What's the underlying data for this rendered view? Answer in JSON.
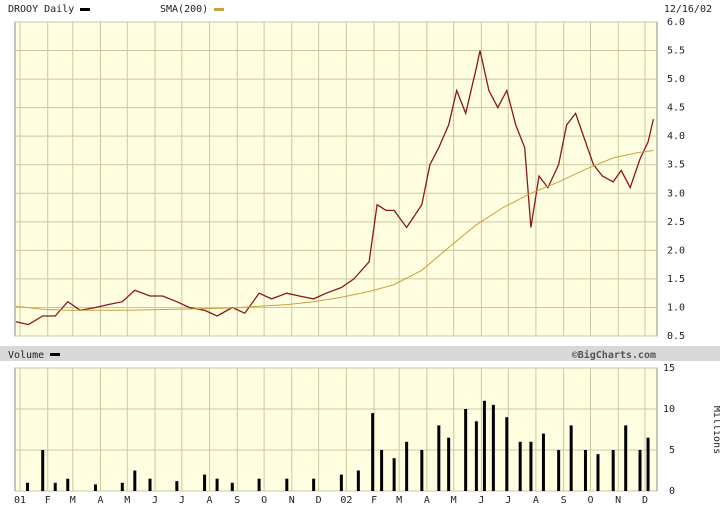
{
  "header": {
    "symbol_label": "DROOY Daily",
    "sma_label": "SMA(200)",
    "date": "12/16/02"
  },
  "volume_header": {
    "label": "Volume",
    "watermark": "©BigCharts.com"
  },
  "colors": {
    "plot_bg": "#fffee0",
    "grid": "#c9c9a0",
    "price_bars": "#8a1818",
    "sma": "#c9a040",
    "volume_bars": "#000000",
    "band": "#d8d8d8"
  },
  "chart_data": [
    {
      "type": "ohlc-line",
      "title": "DROOY Daily",
      "series": [
        {
          "name": "DROOY Daily",
          "points": [
            [
              "2001-01-02",
              0.75
            ],
            [
              "2001-01-16",
              0.7
            ],
            [
              "2001-02-01",
              0.85
            ],
            [
              "2001-02-15",
              0.85
            ],
            [
              "2001-03-01",
              1.1
            ],
            [
              "2001-03-15",
              0.95
            ],
            [
              "2001-04-01",
              1.0
            ],
            [
              "2001-04-15",
              1.05
            ],
            [
              "2001-05-01",
              1.1
            ],
            [
              "2001-05-15",
              1.3
            ],
            [
              "2001-06-01",
              1.2
            ],
            [
              "2001-06-15",
              1.2
            ],
            [
              "2001-07-01",
              1.1
            ],
            [
              "2001-07-15",
              1.0
            ],
            [
              "2001-08-01",
              0.95
            ],
            [
              "2001-08-15",
              0.85
            ],
            [
              "2001-09-01",
              1.0
            ],
            [
              "2001-09-15",
              0.9
            ],
            [
              "2001-10-01",
              1.25
            ],
            [
              "2001-10-15",
              1.15
            ],
            [
              "2001-11-01",
              1.25
            ],
            [
              "2001-11-15",
              1.2
            ],
            [
              "2001-12-01",
              1.15
            ],
            [
              "2001-12-15",
              1.25
            ],
            [
              "2002-01-01",
              1.35
            ],
            [
              "2002-01-15",
              1.5
            ],
            [
              "2002-02-01",
              1.8
            ],
            [
              "2002-02-10",
              2.8
            ],
            [
              "2002-02-20",
              2.7
            ],
            [
              "2002-03-01",
              2.7
            ],
            [
              "2002-03-15",
              2.4
            ],
            [
              "2002-04-01",
              2.8
            ],
            [
              "2002-04-10",
              3.5
            ],
            [
              "2002-04-20",
              3.8
            ],
            [
              "2002-05-01",
              4.2
            ],
            [
              "2002-05-10",
              4.8
            ],
            [
              "2002-05-20",
              4.4
            ],
            [
              "2002-06-01",
              5.2
            ],
            [
              "2002-06-05",
              5.5
            ],
            [
              "2002-06-15",
              4.8
            ],
            [
              "2002-06-25",
              4.5
            ],
            [
              "2002-07-05",
              4.8
            ],
            [
              "2002-07-15",
              4.2
            ],
            [
              "2002-07-25",
              3.8
            ],
            [
              "2002-08-01",
              2.4
            ],
            [
              "2002-08-10",
              3.3
            ],
            [
              "2002-08-20",
              3.1
            ],
            [
              "2002-09-01",
              3.5
            ],
            [
              "2002-09-10",
              4.2
            ],
            [
              "2002-09-20",
              4.4
            ],
            [
              "2002-10-01",
              3.9
            ],
            [
              "2002-10-10",
              3.5
            ],
            [
              "2002-10-20",
              3.3
            ],
            [
              "2002-11-01",
              3.2
            ],
            [
              "2002-11-10",
              3.4
            ],
            [
              "2002-11-20",
              3.1
            ],
            [
              "2002-12-01",
              3.6
            ],
            [
              "2002-12-10",
              3.9
            ],
            [
              "2002-12-16",
              4.3
            ]
          ]
        },
        {
          "name": "SMA(200)",
          "points": [
            [
              "2001-01-02",
              1.02
            ],
            [
              "2001-02-01",
              0.97
            ],
            [
              "2001-03-01",
              0.95
            ],
            [
              "2001-04-01",
              0.95
            ],
            [
              "2001-05-01",
              0.95
            ],
            [
              "2001-06-01",
              0.96
            ],
            [
              "2001-07-01",
              0.97
            ],
            [
              "2001-08-01",
              0.98
            ],
            [
              "2001-09-01",
              0.99
            ],
            [
              "2001-10-01",
              1.02
            ],
            [
              "2001-11-01",
              1.05
            ],
            [
              "2001-12-01",
              1.1
            ],
            [
              "2002-01-01",
              1.18
            ],
            [
              "2002-02-01",
              1.28
            ],
            [
              "2002-03-01",
              1.4
            ],
            [
              "2002-04-01",
              1.65
            ],
            [
              "2002-05-01",
              2.05
            ],
            [
              "2002-06-01",
              2.45
            ],
            [
              "2002-07-01",
              2.75
            ],
            [
              "2002-08-01",
              3.0
            ],
            [
              "2002-09-01",
              3.2
            ],
            [
              "2002-10-01",
              3.42
            ],
            [
              "2002-11-01",
              3.62
            ],
            [
              "2002-12-01",
              3.72
            ],
            [
              "2002-12-16",
              3.75
            ]
          ]
        }
      ],
      "y_ticks": [
        "6.0",
        "5.5",
        "5.0",
        "4.5",
        "4.0",
        "3.5",
        "3.0",
        "2.5",
        "2.0",
        "1.5",
        "1.0",
        "0.5"
      ],
      "ylim": [
        0.5,
        6.0
      ],
      "x_tick_labels": [
        "01",
        "F",
        "M",
        "A",
        "M",
        "J",
        "J",
        "A",
        "S",
        "O",
        "N",
        "D",
        "02",
        "F",
        "M",
        "A",
        "M",
        "J",
        "J",
        "A",
        "S",
        "O",
        "N",
        "D"
      ],
      "xlim": [
        "2001-01-01",
        "2002-12-20"
      ],
      "grid": true,
      "legend": "top-left"
    },
    {
      "type": "bar",
      "title": "Volume",
      "ylabel": "Millions",
      "y_ticks": [
        "15",
        "10",
        "5",
        "0"
      ],
      "ylim": [
        0,
        15
      ],
      "x_tick_labels": [
        "01",
        "F",
        "M",
        "A",
        "M",
        "J",
        "J",
        "A",
        "S",
        "O",
        "N",
        "D",
        "02",
        "F",
        "M",
        "A",
        "M",
        "J",
        "J",
        "A",
        "S",
        "O",
        "N",
        "D"
      ],
      "xlim": [
        "2001-01-01",
        "2002-12-20"
      ],
      "series": [
        {
          "points": [
            [
              "2001-01-15",
              1.0
            ],
            [
              "2001-02-01",
              5.0
            ],
            [
              "2001-02-15",
              1.0
            ],
            [
              "2001-03-01",
              1.5
            ],
            [
              "2001-04-01",
              0.8
            ],
            [
              "2001-05-01",
              1.0
            ],
            [
              "2001-05-15",
              2.5
            ],
            [
              "2001-06-01",
              1.5
            ],
            [
              "2001-07-01",
              1.2
            ],
            [
              "2001-08-01",
              2.0
            ],
            [
              "2001-08-15",
              1.5
            ],
            [
              "2001-09-01",
              1.0
            ],
            [
              "2001-10-01",
              1.5
            ],
            [
              "2001-11-01",
              1.5
            ],
            [
              "2001-12-01",
              1.5
            ],
            [
              "2002-01-01",
              2.0
            ],
            [
              "2002-01-20",
              2.5
            ],
            [
              "2002-02-05",
              9.5
            ],
            [
              "2002-02-15",
              5.0
            ],
            [
              "2002-03-01",
              4.0
            ],
            [
              "2002-03-15",
              6.0
            ],
            [
              "2002-04-01",
              5.0
            ],
            [
              "2002-04-20",
              8.0
            ],
            [
              "2002-05-01",
              6.5
            ],
            [
              "2002-05-20",
              10.0
            ],
            [
              "2002-06-01",
              8.5
            ],
            [
              "2002-06-10",
              11.0
            ],
            [
              "2002-06-20",
              10.5
            ],
            [
              "2002-07-05",
              9.0
            ],
            [
              "2002-07-20",
              6.0
            ],
            [
              "2002-08-01",
              6.0
            ],
            [
              "2002-08-15",
              7.0
            ],
            [
              "2002-09-01",
              5.0
            ],
            [
              "2002-09-15",
              8.0
            ],
            [
              "2002-10-01",
              5.0
            ],
            [
              "2002-10-15",
              4.5
            ],
            [
              "2002-11-01",
              5.0
            ],
            [
              "2002-11-15",
              8.0
            ],
            [
              "2002-12-01",
              5.0
            ],
            [
              "2002-12-10",
              6.5
            ]
          ]
        }
      ]
    }
  ]
}
